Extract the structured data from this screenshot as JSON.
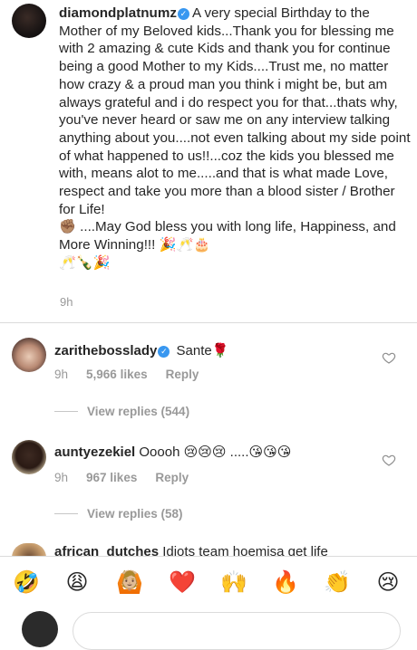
{
  "post": {
    "username": "diamondplatnumz",
    "caption": "A very special Birthday to the Mother of my Beloved kids...Thank you for blessing me with 2 amazing & cute Kids and thank you for continue being a good Mother to my Kids....Trust me, no matter how crazy & a proud man you think i might be, but am always grateful and i do respect you for that...thats why, you've never heard or saw me on any interview talking anything about you....not even talking about my side point of what happened to us!!...coz the kids you blessed me with, means alot to me.....and that is what made Love,  respect and take you more than a blood sister / Brother for Life!\n✊🏽 ....May God bless you with long life, Happiness, and More Winning!!! 🎉🥂🎂\n🥂🍾🎉",
    "time": "9h"
  },
  "comments": [
    {
      "username": "zarithebosslady",
      "text": "Sante🌹",
      "time": "9h",
      "likes": "5,966 likes",
      "reply": "Reply",
      "view_replies": "View replies (544)"
    },
    {
      "username": "auntyezekiel",
      "text": "Ooooh 😢😢😢 .....😘😘😘",
      "time": "9h",
      "likes": "967 likes",
      "reply": "Reply",
      "view_replies": "View replies (58)"
    },
    {
      "username": "african_dutches",
      "text": "Idiots team hoemisa  get life"
    }
  ],
  "emoji_bar": [
    "🤣",
    "😩",
    "🙆🏼",
    "❤️",
    "🙌",
    "🔥",
    "👏",
    "😢"
  ],
  "icons": {
    "verified": "verified-badge-icon",
    "like": "heart-outline-icon"
  },
  "colors": {
    "text": "#262626",
    "secondary": "#999999",
    "verified": "#3897f0",
    "divider": "#dbdbdb"
  }
}
